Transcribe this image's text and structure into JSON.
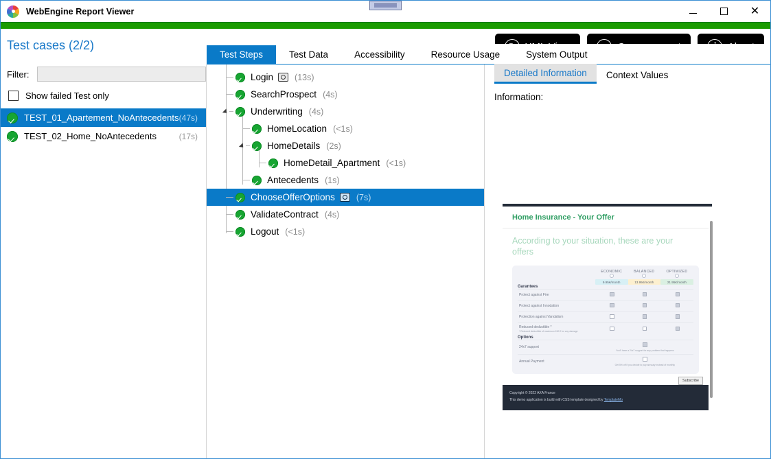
{
  "window": {
    "title": "WebEngine Report Viewer",
    "logo_icon": "pinwheel-logo",
    "minimize": "minimize-icon",
    "maximize": "maximize-icon",
    "close": "close-icon"
  },
  "toolbar": {
    "test_cases_label": "Test cases (2/2)",
    "buttons": [
      {
        "label": "XML View",
        "icon": "xml-document-icon"
      },
      {
        "label": "Open a report",
        "icon": "folder-open-icon"
      },
      {
        "label": "About",
        "icon": "info-icon"
      }
    ]
  },
  "left_panel": {
    "filter_label": "Filter:",
    "filter_value": "",
    "filter_placeholder": "",
    "show_failed_label": "Show failed Test only",
    "show_failed_checked": false,
    "test_cases": [
      {
        "name": "TEST_01_Apartement_NoAntecedents",
        "duration": "(47s)",
        "status": "passed",
        "selected": true
      },
      {
        "name": "TEST_02_Home_NoAntecedents",
        "duration": "(17s)",
        "status": "passed",
        "selected": false
      }
    ]
  },
  "tabs": [
    {
      "label": "Test Steps",
      "active": true
    },
    {
      "label": "Test Data",
      "active": false
    },
    {
      "label": "Accessibility",
      "active": false
    },
    {
      "label": "Resource Usage",
      "active": false
    },
    {
      "label": "System Output",
      "active": false
    }
  ],
  "tree": [
    {
      "name": "Login",
      "duration": "(13s)",
      "depth": 0,
      "status": "passed",
      "has_screenshot": true,
      "expander": "none",
      "selected": false
    },
    {
      "name": "SearchProspect",
      "duration": "(4s)",
      "depth": 0,
      "status": "passed",
      "has_screenshot": false,
      "expander": "none",
      "selected": false
    },
    {
      "name": "Underwriting",
      "duration": "(4s)",
      "depth": 0,
      "status": "passed",
      "has_screenshot": false,
      "expander": "expanded",
      "selected": false
    },
    {
      "name": "HomeLocation",
      "duration": "(<1s)",
      "depth": 1,
      "status": "passed",
      "has_screenshot": false,
      "expander": "none",
      "selected": false
    },
    {
      "name": "HomeDetails",
      "duration": "(2s)",
      "depth": 1,
      "status": "passed",
      "has_screenshot": false,
      "expander": "expanded",
      "selected": false
    },
    {
      "name": "HomeDetail_Apartment",
      "duration": "(<1s)",
      "depth": 2,
      "status": "passed",
      "has_screenshot": false,
      "expander": "none",
      "selected": false
    },
    {
      "name": "Antecedents",
      "duration": "(1s)",
      "depth": 1,
      "status": "passed",
      "has_screenshot": false,
      "expander": "none",
      "selected": false
    },
    {
      "name": "ChooseOfferOptions",
      "duration": "(7s)",
      "depth": 0,
      "status": "passed",
      "has_screenshot": true,
      "expander": "none",
      "selected": true
    },
    {
      "name": "ValidateContract",
      "duration": "(4s)",
      "depth": 0,
      "status": "passed",
      "has_screenshot": false,
      "expander": "none",
      "selected": false
    },
    {
      "name": "Logout",
      "duration": "(<1s)",
      "depth": 0,
      "status": "passed",
      "has_screenshot": false,
      "expander": "none",
      "selected": false
    }
  ],
  "right_panel": {
    "sub_tabs": [
      {
        "label": "Detailed Information",
        "active": true
      },
      {
        "label": "Context Values",
        "active": false
      }
    ],
    "information_label": "Information:"
  },
  "screenshot": {
    "page_title": "Home Insurance - Your Offer",
    "subtitle": "According to your situation, these are your offers",
    "plans": [
      {
        "name": "ECONOMIC",
        "price": "9.95€/month"
      },
      {
        "name": "BALANCED",
        "price": "13.95€/month"
      },
      {
        "name": "OPTIMIZED",
        "price": "21.95€/month"
      }
    ],
    "guarantees_heading": "Garantees",
    "guarantees": [
      {
        "label": "Protect against Fire",
        "note": "",
        "values": [
          "on",
          "on",
          "on"
        ]
      },
      {
        "label": "Protect against Innodation",
        "note": "",
        "values": [
          "on",
          "on",
          "on"
        ]
      },
      {
        "label": "Protection against Vandalism",
        "note": "",
        "values": [
          "off",
          "on",
          "on"
        ]
      },
      {
        "label": "Reduced deductible *",
        "note": "* Reduced deductible of maximum 150 € for any damage",
        "values": [
          "off",
          "off",
          "on"
        ]
      }
    ],
    "options_heading": "Options",
    "options": [
      {
        "label": "24x7 support",
        "note": "You'll have a 24x7 support for any problem that happens",
        "value": "on"
      },
      {
        "label": "Annual Payment",
        "note": "Get 5% off if you decide to pay annualy instead of monthly",
        "value": "off"
      }
    ],
    "subscribe_label": "Subscribe",
    "footer_copyright": "Copyright © 2022 AXA France",
    "footer_credit_prefix": "This demo application is build with CSS template designed by ",
    "footer_credit_link": "TemplateMo"
  },
  "colors": {
    "accent_blue": "#0a7ac8",
    "status_green": "#1a9b00",
    "link_blue": "#1878c8",
    "dark_button": "#000000"
  }
}
